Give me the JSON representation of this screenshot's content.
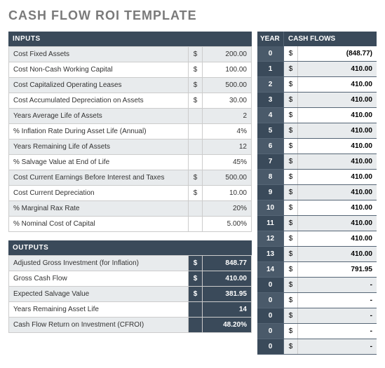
{
  "title": "CASH FLOW ROI TEMPLATE",
  "inputs_header": "INPUTS",
  "outputs_header": "OUTPUTS",
  "year_header": "YEAR",
  "cashflows_header": "CASH FLOWS",
  "inputs": [
    {
      "label": "Cost Fixed Assets",
      "dollar": "$",
      "value": "200.00"
    },
    {
      "label": "Cost Non-Cash Working Capital",
      "dollar": "$",
      "value": "100.00"
    },
    {
      "label": "Cost Capitalized Operating Leases",
      "dollar": "$",
      "value": "500.00"
    },
    {
      "label": "Cost Accumulated Depreciation on Assets",
      "dollar": "$",
      "value": "30.00"
    },
    {
      "label": "Years Average Life of Assets",
      "dollar": "",
      "value": "2"
    },
    {
      "label": "% Inflation Rate During Asset Life (Annual)",
      "dollar": "",
      "value": "4%"
    },
    {
      "label": "Years Remaining Life of Assets",
      "dollar": "",
      "value": "12"
    },
    {
      "label": "% Salvage Value at End of Life",
      "dollar": "",
      "value": "45%"
    },
    {
      "label": "Cost Current Earnings Before Interest and Taxes",
      "dollar": "$",
      "value": "500.00"
    },
    {
      "label": "Cost Current Depreciation",
      "dollar": "$",
      "value": "10.00"
    },
    {
      "label": "% Marginal Rax Rate",
      "dollar": "",
      "value": "20%"
    },
    {
      "label": "% Nominal Cost of Capital",
      "dollar": "",
      "value": "5.00%"
    }
  ],
  "outputs": [
    {
      "label": "Adjusted Gross Investment (for Inflation)",
      "dollar": "$",
      "value": "848.77"
    },
    {
      "label": "Gross Cash Flow",
      "dollar": "$",
      "value": "410.00"
    },
    {
      "label": "Expected Salvage Value",
      "dollar": "$",
      "value": "381.95"
    },
    {
      "label": "Years Remaining Asset Life",
      "dollar": "",
      "value": "14"
    },
    {
      "label": "Cash Flow Return on Investment (CFROI)",
      "dollar": "",
      "value": "48.20%"
    }
  ],
  "cashflows": [
    {
      "year": "0",
      "dollar": "$",
      "value": "(848.77)"
    },
    {
      "year": "1",
      "dollar": "$",
      "value": "410.00"
    },
    {
      "year": "2",
      "dollar": "$",
      "value": "410.00"
    },
    {
      "year": "3",
      "dollar": "$",
      "value": "410.00"
    },
    {
      "year": "4",
      "dollar": "$",
      "value": "410.00"
    },
    {
      "year": "5",
      "dollar": "$",
      "value": "410.00"
    },
    {
      "year": "6",
      "dollar": "$",
      "value": "410.00"
    },
    {
      "year": "7",
      "dollar": "$",
      "value": "410.00"
    },
    {
      "year": "8",
      "dollar": "$",
      "value": "410.00"
    },
    {
      "year": "9",
      "dollar": "$",
      "value": "410.00"
    },
    {
      "year": "10",
      "dollar": "$",
      "value": "410.00"
    },
    {
      "year": "11",
      "dollar": "$",
      "value": "410.00"
    },
    {
      "year": "12",
      "dollar": "$",
      "value": "410.00"
    },
    {
      "year": "13",
      "dollar": "$",
      "value": "410.00"
    },
    {
      "year": "14",
      "dollar": "$",
      "value": "791.95"
    },
    {
      "year": "0",
      "dollar": "$",
      "value": "-"
    },
    {
      "year": "0",
      "dollar": "$",
      "value": "-"
    },
    {
      "year": "0",
      "dollar": "$",
      "value": "-"
    },
    {
      "year": "0",
      "dollar": "$",
      "value": "-"
    },
    {
      "year": "0",
      "dollar": "$",
      "value": "-"
    }
  ]
}
